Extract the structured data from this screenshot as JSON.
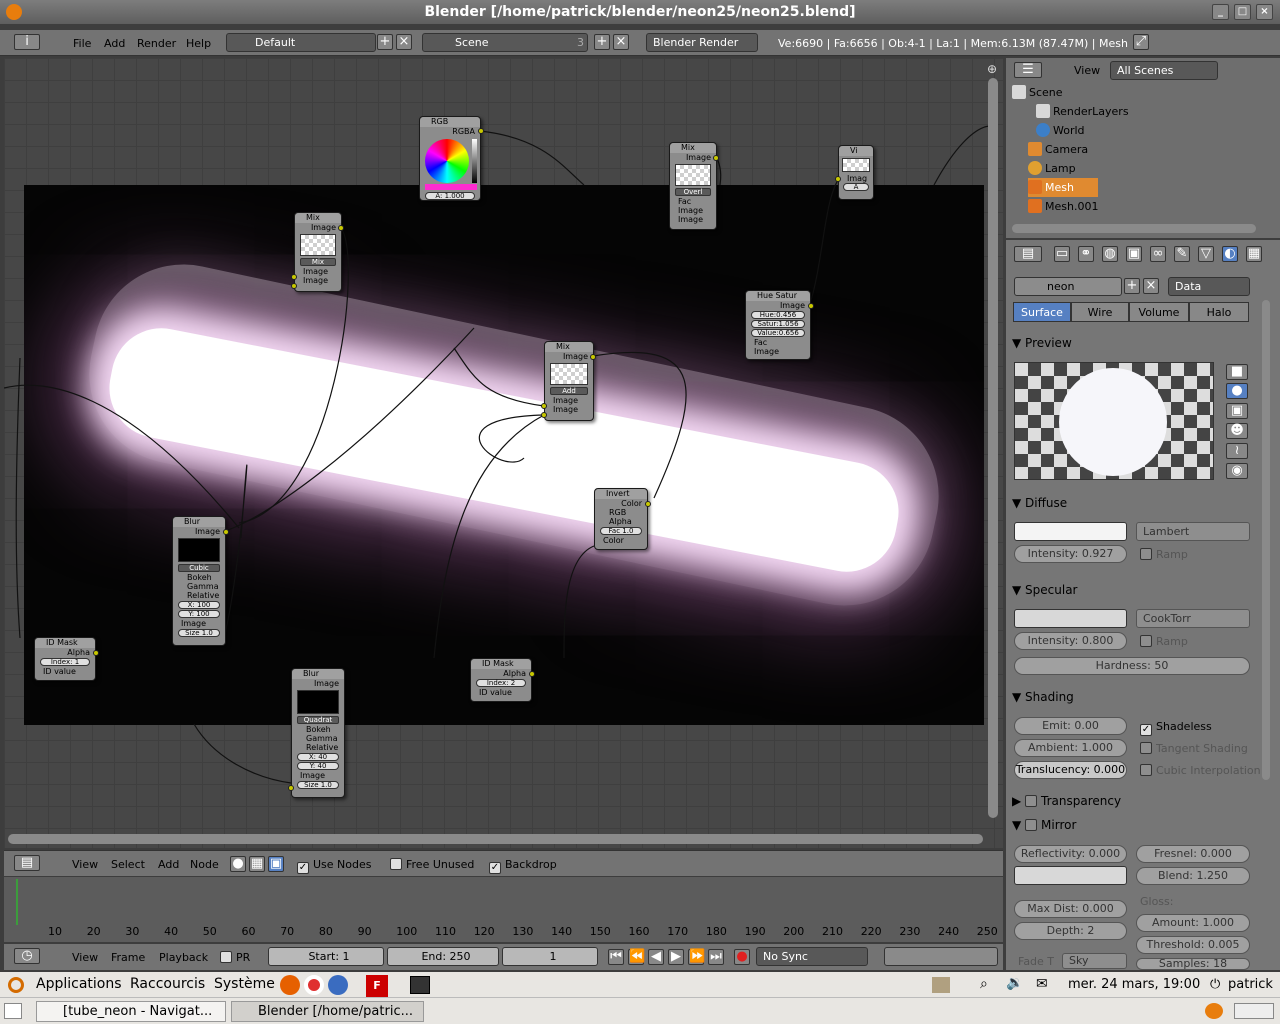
{
  "window": {
    "title": "Blender [/home/patrick/blender/neon25/neon25.blend]"
  },
  "infobar": {
    "menus": [
      "File",
      "Add",
      "Render",
      "Help"
    ],
    "screen": "Default",
    "scene": "Scene",
    "scene_users": "3",
    "engine": "Blender Render",
    "stats": "Ve:6690 | Fa:6656 | Ob:4-1 | La:1 | Mem:6.13M (87.47M) | Mesh"
  },
  "nodes": {
    "rgb": {
      "title": "RGB",
      "out": "RGBA",
      "alpha": "A: 1.000"
    },
    "mix1": {
      "title": "Mix",
      "out": "Image",
      "mode": "Mix",
      "in1": "Image",
      "in2": "Image"
    },
    "mix2": {
      "title": "Mix",
      "out": "Image",
      "mode": "Overl",
      "in0": "Fac",
      "in1": "Image",
      "in2": "Image"
    },
    "viewer": {
      "title": "Vi",
      "in": "Imag",
      "a": "A"
    },
    "hue": {
      "title": "Hue Satur",
      "out": "Image",
      "hue": "Hue:0.456",
      "sat": "Satur:1.056",
      "val": "Value:0.656",
      "fac": "Fac",
      "in": "Image"
    },
    "mix3": {
      "title": "Mix",
      "out": "Image",
      "mode": "Add",
      "in1": "Image",
      "in2": "Image"
    },
    "invert": {
      "title": "Invert",
      "out": "Color",
      "rgb": "RGB",
      "alpha": "Alpha",
      "fac": "Fac 1.0",
      "in": "Color"
    },
    "blur1": {
      "title": "Blur",
      "out": "Image",
      "filter": "Cubic",
      "bokeh": "Bokeh",
      "gamma": "Gamma",
      "relative": "Relative",
      "x": "X: 100",
      "y": "Y: 100",
      "in": "Image",
      "size": "Size 1.0"
    },
    "blur2": {
      "title": "Blur",
      "out": "Image",
      "filter": "Quadrat",
      "bokeh": "Bokeh",
      "gamma": "Gamma",
      "relative": "Relative",
      "x": "X: 40",
      "y": "Y: 40",
      "in": "Image",
      "size": "Size 1.0"
    },
    "idmask1": {
      "title": "ID Mask",
      "out": "Alpha",
      "index": "Index: 1",
      "in": "ID value"
    },
    "idmask2": {
      "title": "ID Mask",
      "out": "Alpha",
      "index": "Index: 2",
      "in": "ID value"
    }
  },
  "node_header": {
    "menus": [
      "View",
      "Select",
      "Add",
      "Node"
    ],
    "use_nodes": "Use Nodes",
    "free_unused": "Free Unused",
    "backdrop": "Backdrop"
  },
  "timeline": {
    "ticks": [
      "10",
      "20",
      "30",
      "40",
      "50",
      "60",
      "70",
      "80",
      "90",
      "100",
      "110",
      "120",
      "130",
      "140",
      "150",
      "160",
      "170",
      "180",
      "190",
      "200",
      "210",
      "220",
      "230",
      "240",
      "250"
    ],
    "menus": [
      "View",
      "Frame",
      "Playback"
    ],
    "pr": "PR",
    "start": "Start: 1",
    "end": "End: 250",
    "current": "1",
    "sync": "No Sync"
  },
  "outliner": {
    "view": "View",
    "filter": "All Scenes",
    "items": [
      "Scene",
      "RenderLayers",
      "World",
      "Camera",
      "Lamp",
      "Mesh",
      "Mesh.001"
    ]
  },
  "properties": {
    "material": "neon",
    "data": "Data",
    "tabs": [
      "Surface",
      "Wire",
      "Volume",
      "Halo"
    ],
    "preview": "Preview",
    "diffuse": {
      "title": "Diffuse",
      "shader": "Lambert",
      "intensity": "Intensity: 0.927",
      "ramp": "Ramp"
    },
    "specular": {
      "title": "Specular",
      "shader": "CookTorr",
      "intensity": "Intensity: 0.800",
      "ramp": "Ramp",
      "hardness": "Hardness: 50"
    },
    "shading": {
      "title": "Shading",
      "emit": "Emit: 0.00",
      "ambient": "Ambient: 1.000",
      "translucency": "Translucency: 0.000",
      "shadeless": "Shadeless",
      "tangent": "Tangent Shading",
      "cubic": "Cubic Interpolation"
    },
    "transparency": "Transparency",
    "mirror": {
      "title": "Mirror",
      "reflectivity": "Reflectivity: 0.000",
      "fresnel": "Fresnel: 0.000",
      "blend": "Blend: 1.250",
      "maxdist": "Max Dist: 0.000",
      "depth": "Depth: 2",
      "gloss": "Gloss:",
      "amount": "Amount: 1.000",
      "threshold": "Threshold: 0.005",
      "samples": "Samples: 18",
      "fade": "Fade T",
      "sky": "Sky"
    }
  },
  "taskbar": {
    "menus": [
      "Applications",
      "Raccourcis",
      "Système"
    ],
    "clock": "mer. 24 mars, 19:00",
    "user": "patrick",
    "windows": [
      "[tube_neon - Navigat...",
      "Blender [/home/patric..."
    ]
  },
  "colors": {
    "accent": "#5680c2",
    "socket": "#c8c800",
    "glow": "#f3d8f3"
  }
}
